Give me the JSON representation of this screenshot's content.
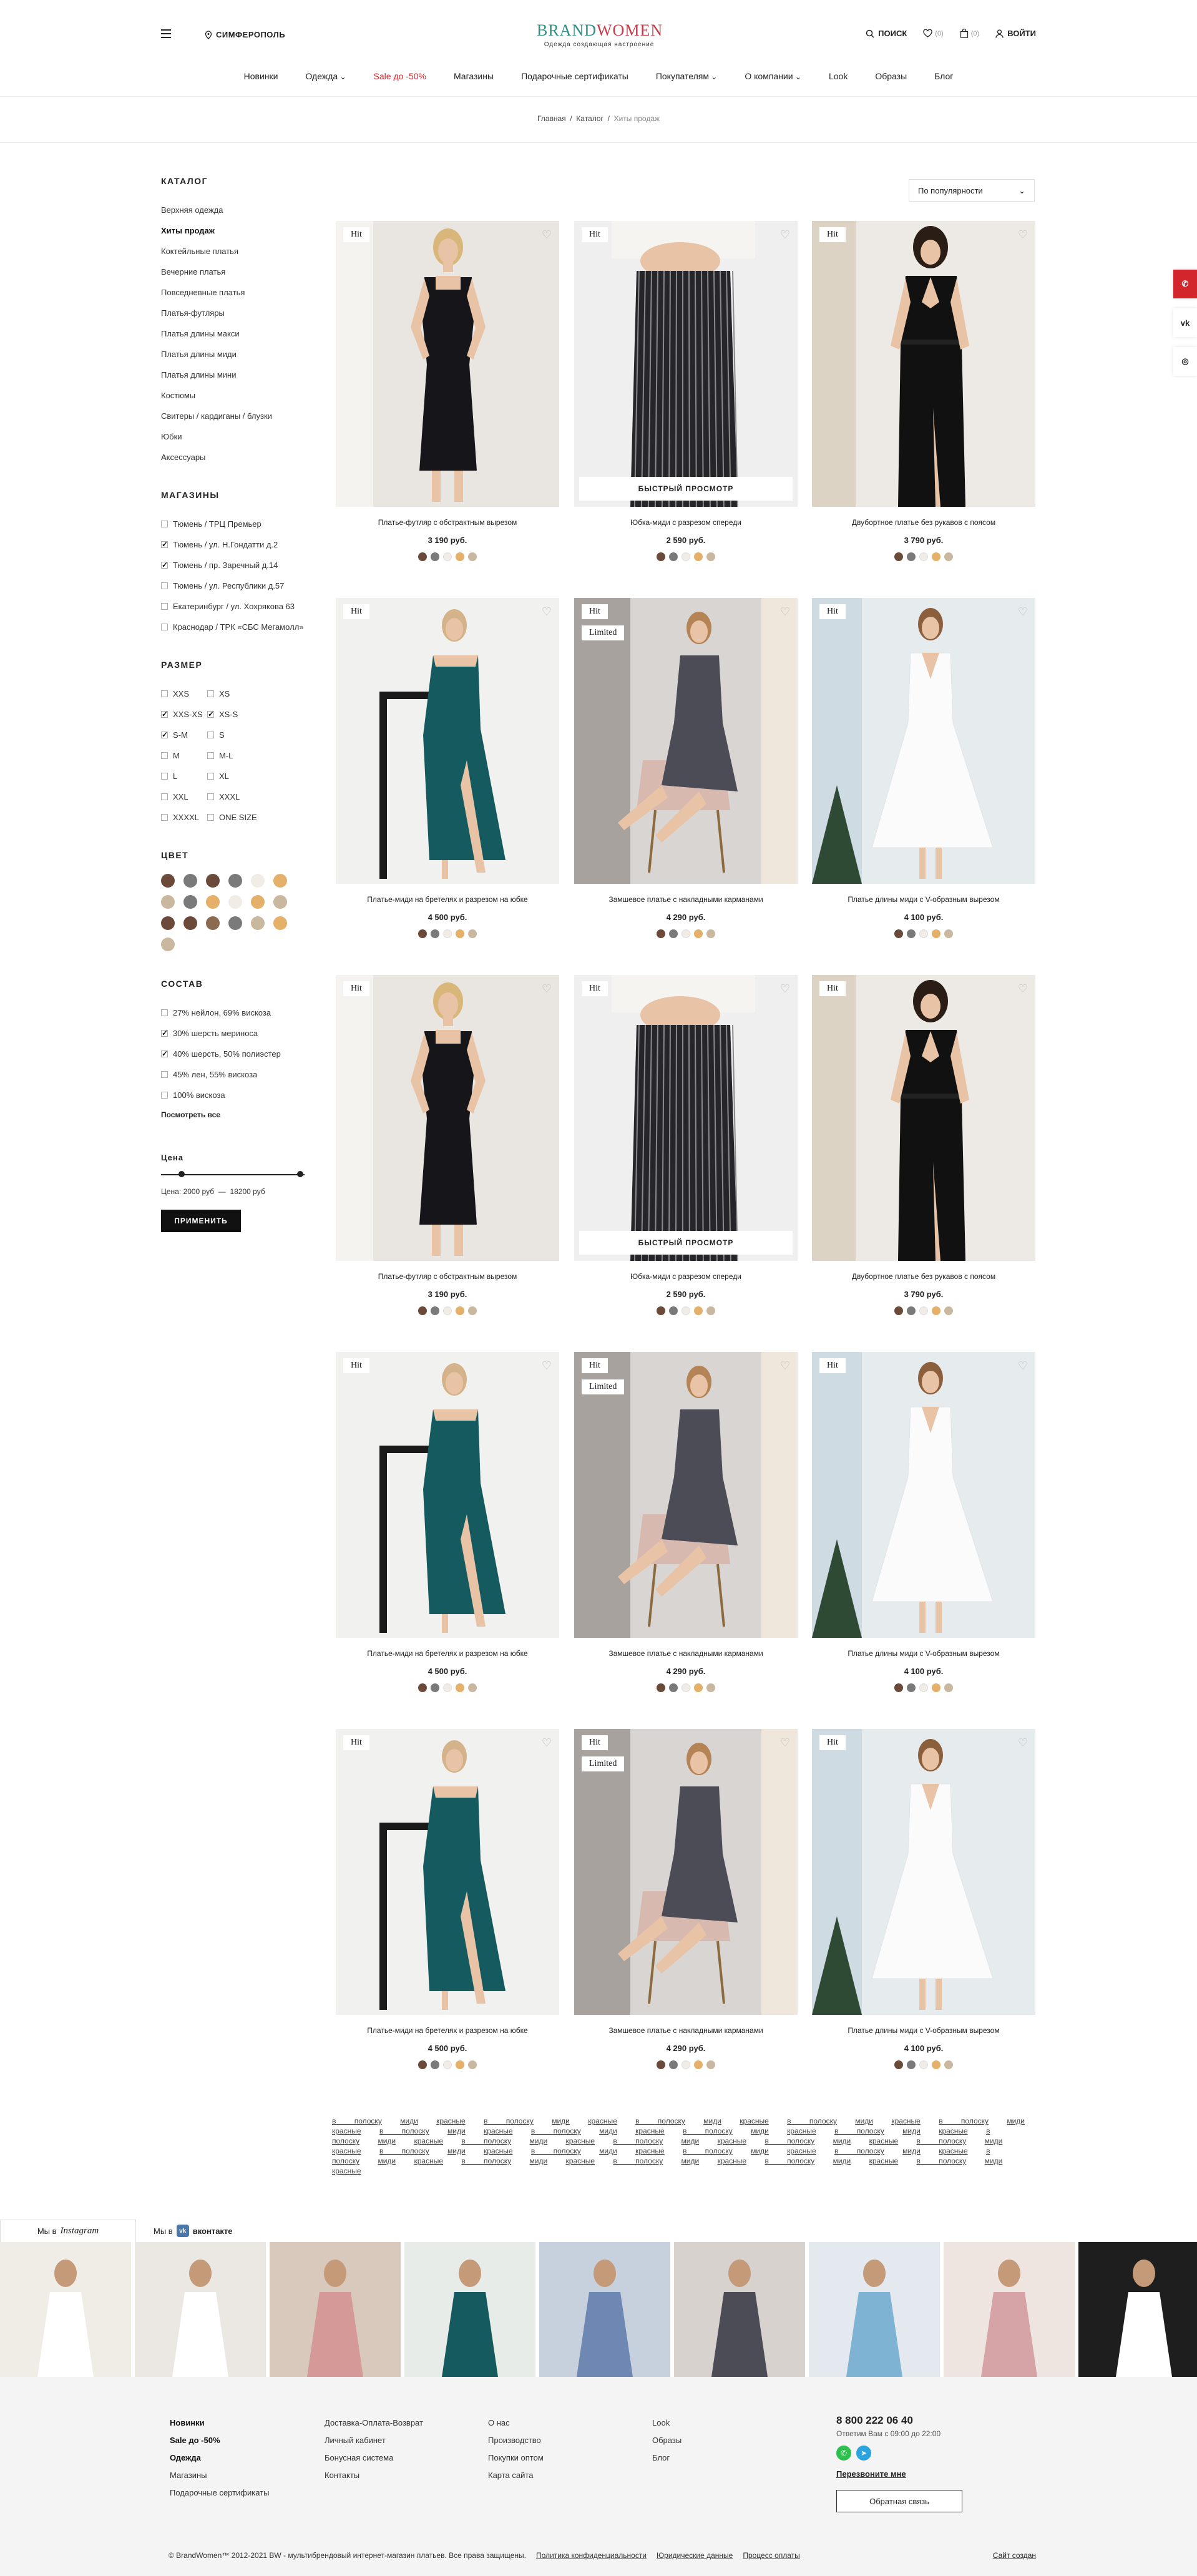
{
  "header": {
    "city": "СИМФЕРОПОЛЬ",
    "logo_part1": "BRAND",
    "logo_part2": "WOMEN",
    "logo_tagline": "Одежда создающая настроение",
    "search_label": "ПОИСК",
    "favorites_count": "(0)",
    "cart_count": "(0)",
    "login_label": "ВОЙТИ",
    "nav": [
      "Новинки",
      "Одежда",
      "Sale до -50%",
      "Магазины",
      "Подарочные сертификаты",
      "Покупателям",
      "О компании",
      "Look",
      "Образы",
      "Блог"
    ]
  },
  "breadcrumb": {
    "home": "Главная",
    "catalog": "Каталог",
    "current": "Хиты продаж"
  },
  "sort": {
    "label": "По популярности"
  },
  "sidebar": {
    "catalog_title": "КАТАЛОГ",
    "catalog": [
      "Верхняя одежда",
      "Хиты продаж",
      "Коктейльные платья",
      "Вечерние платья",
      "Повседневные платья",
      "Платья-футляры",
      "Платья длины макси",
      "Платья длины миди",
      "Платья длины мини",
      "Костюмы",
      "Свитеры / кардиганы / блузки",
      "Юбки",
      "Аксессуары"
    ],
    "stores_title": "МАГАЗИНЫ",
    "stores": [
      {
        "label": "Тюмень / ТРЦ Премьер",
        "on": false
      },
      {
        "label": "Тюмень / ул. Н.Гондатти д.2",
        "on": true
      },
      {
        "label": "Тюмень / пр. Заречный д.14",
        "on": true
      },
      {
        "label": "Тюмень / ул. Республики д.57",
        "on": false
      },
      {
        "label": "Екатеринбург / ул. Хохрякова 63",
        "on": false
      },
      {
        "label": "Краснодар / ТРК «СБС Мегамолл»",
        "on": false
      }
    ],
    "size_title": "РАЗМЕР",
    "sizes": [
      {
        "label": "XXS",
        "on": false
      },
      {
        "label": "XS",
        "on": false
      },
      {
        "label": "XXS-XS",
        "on": true
      },
      {
        "label": "XS-S",
        "on": true
      },
      {
        "label": "S-M",
        "on": true
      },
      {
        "label": "S",
        "on": false
      },
      {
        "label": "M",
        "on": false
      },
      {
        "label": "M-L",
        "on": false
      },
      {
        "label": "L",
        "on": false
      },
      {
        "label": "XL",
        "on": false
      },
      {
        "label": "XXL",
        "on": false
      },
      {
        "label": "XXXL",
        "on": false
      },
      {
        "label": "XXXXL",
        "on": false
      },
      {
        "label": "ONE SIZE",
        "on": false
      }
    ],
    "color_title": "ЦВЕТ",
    "colors": [
      "#6b4a3a",
      "#7a7a7a",
      "#6b4a3a",
      "#7a7a7a",
      "#f1ede6",
      "#e4b06a",
      "#c9b89f",
      "#7a7a7a",
      "#e4b06a",
      "#f1ede6",
      "#e4b06a",
      "#c9b89f",
      "#6b4a3a",
      "#6b4a3a",
      "#8b6a4f",
      "#7a7a7a",
      "#c9b89f",
      "#e4b06a",
      "#c9b89f"
    ],
    "comp_title": "СОСТАВ",
    "composition": [
      {
        "label": "27% нейлон, 69% вискоза",
        "on": false
      },
      {
        "label": "30% шерсть мериноса",
        "on": true
      },
      {
        "label": "40% шерсть, 50% полиэстер",
        "on": true
      },
      {
        "label": "45% лен, 55% вискоза",
        "on": false
      },
      {
        "label": "100% вискоза",
        "on": false
      }
    ],
    "show_all": "Посмотреть все",
    "price_title": "Цена",
    "price_from": "Цена: 2000 руб",
    "price_dash": "—",
    "price_to": "18200 руб",
    "apply": "ПРИМЕНИТЬ"
  },
  "products": [
    {
      "tag": "Hit",
      "tag2": "",
      "name": "Платье-футляр с обстрактным вырезом",
      "price": "3 190 руб.",
      "quickview": "",
      "look": "black-sheath"
    },
    {
      "tag": "Hit",
      "tag2": "",
      "name": "Юбка-миди с разрезом спереди",
      "price": "2 590 руб.",
      "quickview": "БЫСТРЫЙ ПРОСМОТР",
      "look": "striped-skirt"
    },
    {
      "tag": "Hit",
      "tag2": "",
      "name": "Двубортное платье без рукавов с поясом",
      "price": "3 790 руб.",
      "quickview": "",
      "look": "black-dbl"
    },
    {
      "tag": "Hit",
      "tag2": "",
      "name": "Платье-миди на бретелях и разрезом на юбке",
      "price": "4 500 руб.",
      "quickview": "",
      "look": "teal-dress"
    },
    {
      "tag": "Hit",
      "tag2": "Limited",
      "name": "Замшевое платье с накладными карманами",
      "price": "4 290 руб.",
      "quickview": "",
      "look": "grey-suede"
    },
    {
      "tag": "Hit",
      "tag2": "",
      "name": "Платье длины миди с V-образным вырезом",
      "price": "4 100 руб.",
      "quickview": "",
      "look": "white-dress"
    },
    {
      "tag": "Hit",
      "tag2": "",
      "name": "Платье-футляр с обстрактным вырезом",
      "price": "3 190 руб.",
      "quickview": "",
      "look": "black-sheath"
    },
    {
      "tag": "Hit",
      "tag2": "",
      "name": "Юбка-миди с разрезом спереди",
      "price": "2 590 руб.",
      "quickview": "БЫСТРЫЙ ПРОСМОТР",
      "look": "striped-skirt"
    },
    {
      "tag": "Hit",
      "tag2": "",
      "name": "Двубортное платье без рукавов с поясом",
      "price": "3 790 руб.",
      "quickview": "",
      "look": "black-dbl"
    },
    {
      "tag": "Hit",
      "tag2": "",
      "name": "Платье-миди на бретелях и разрезом на юбке",
      "price": "4 500 руб.",
      "quickview": "",
      "look": "teal-dress"
    },
    {
      "tag": "Hit",
      "tag2": "Limited",
      "name": "Замшевое платье с накладными карманами",
      "price": "4 290 руб.",
      "quickview": "",
      "look": "grey-suede"
    },
    {
      "tag": "Hit",
      "tag2": "",
      "name": "Платье длины миди с V-образным вырезом",
      "price": "4 100 руб.",
      "quickview": "",
      "look": "white-dress"
    },
    {
      "tag": "Hit",
      "tag2": "",
      "name": "Платье-миди на бретелях и разрезом на юбке",
      "price": "4 500 руб.",
      "quickview": "",
      "look": "teal-dress"
    },
    {
      "tag": "Hit",
      "tag2": "Limited",
      "name": "Замшевое платье с накладными карманами",
      "price": "4 290 руб.",
      "quickview": "",
      "look": "grey-suede"
    },
    {
      "tag": "Hit",
      "tag2": "",
      "name": "Платье длины миди с V-образным вырезом",
      "price": "4 100 руб.",
      "quickview": "",
      "look": "white-dress"
    }
  ],
  "product_dots": [
    "#6b4a3a",
    "#7a7a7a",
    "#f1ede6",
    "#e4b06a",
    "#c9b89f"
  ],
  "tag_cloud": [
    "в полоску",
    "миди",
    "красные",
    "в полоску",
    "миди",
    "красные",
    "в полоску",
    "миди",
    "красные",
    "в полоску",
    "миди",
    "красные",
    "в полоску",
    "миди",
    "красные",
    "в полоску",
    "миди",
    "красные",
    "в полоску",
    "миди",
    "красные",
    "в полоску",
    "миди",
    "красные",
    "в полоску",
    "миди",
    "красные",
    "в полоску",
    "миди",
    "красные",
    "в полоску",
    "миди",
    "красные",
    "в полоску",
    "миди",
    "красные",
    "в полоску",
    "миди",
    "красные",
    "в полоску",
    "миди",
    "красные",
    "в полоску",
    "миди",
    "красные",
    "в полоску",
    "миди",
    "красные",
    "в полоску",
    "миди",
    "красные",
    "в полоску",
    "миди",
    "красные",
    "в полоску",
    "миди",
    "красные",
    "в полоску",
    "миди",
    "красные",
    "в полоску",
    "миди",
    "красные",
    "в полоску",
    "миди",
    "красные",
    "в полоску",
    "миди",
    "красные"
  ],
  "social": {
    "insta_prefix": "Мы в",
    "insta_name": "Instagram",
    "vk_prefix": "Мы в",
    "vk_name": "вконтакте"
  },
  "gallery": [
    "#f0ece6",
    "#ebe8e3",
    "#d9c9bd",
    "#e7ece9",
    "#c7d0dd",
    "#d8d2cf",
    "#e3e9ee",
    "#eee4e0",
    "#1e1e1e"
  ],
  "footer": {
    "col1": [
      "Новинки",
      "Sale до -50%",
      "Одежда",
      "Магазины",
      "Подарочные сертификаты"
    ],
    "col2": [
      "Доставка-Оплата-Возврат",
      "Личный кабинет",
      "Бонусная система",
      "Контакты"
    ],
    "col3": [
      "О нас",
      "Производство",
      "Покупки оптом",
      "Карта сайта"
    ],
    "col4": [
      "Look",
      "Образы",
      "Блог"
    ],
    "phone": "8 800 222 06 40",
    "phone_sub": "Ответим Вам с 09:00 до 22:00",
    "callme": "Перезвоните мне",
    "feedback": "Обратная связь",
    "copyright": "© BrandWomen™ 2012-2021 BW - мультибрендовый интернет-магазин платьев. Все права защищены.",
    "policy": "Политика конфиденциальности",
    "legal": "Юридические данные",
    "payment": "Процесс оплаты",
    "created": "Сайт создан"
  }
}
